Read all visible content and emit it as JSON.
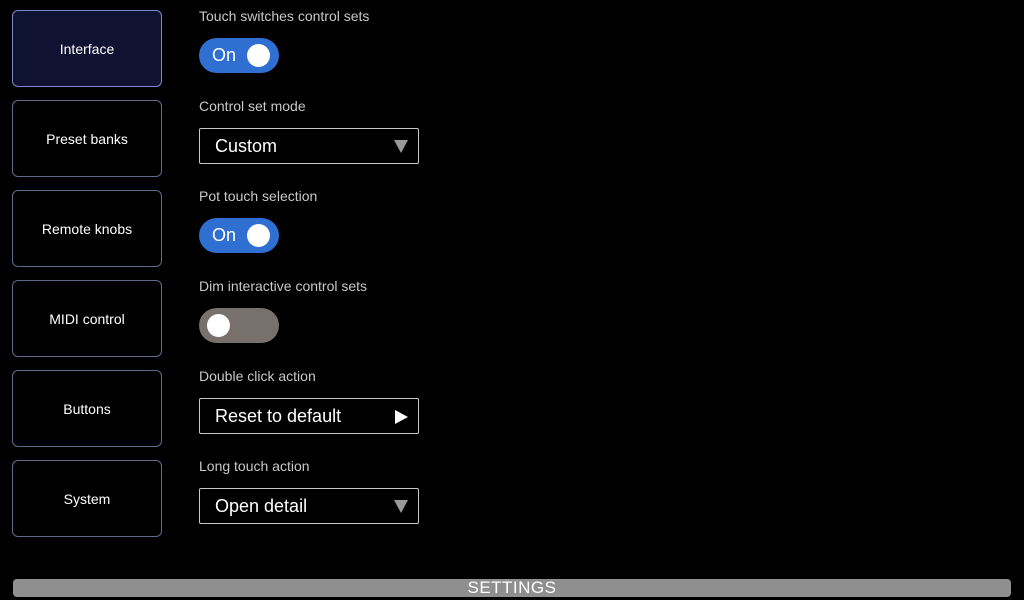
{
  "sidebar": {
    "items": [
      {
        "label": "Interface",
        "active": true
      },
      {
        "label": "Preset banks",
        "active": false
      },
      {
        "label": "Remote knobs",
        "active": false
      },
      {
        "label": "MIDI control",
        "active": false
      },
      {
        "label": "Buttons",
        "active": false
      },
      {
        "label": "System",
        "active": false
      }
    ]
  },
  "settings": {
    "touch_switches": {
      "label": "Touch switches control sets",
      "state": "On",
      "enabled": true
    },
    "control_set_mode": {
      "label": "Control set mode",
      "value": "Custom",
      "icon": "chevron-down-icon"
    },
    "pot_touch": {
      "label": "Pot touch selection",
      "state": "On",
      "enabled": true
    },
    "dim_interactive": {
      "label": "Dim interactive control sets",
      "state": "",
      "enabled": false
    },
    "double_click": {
      "label": "Double click action",
      "value": "Reset to default",
      "icon": "play-arrow-icon"
    },
    "long_touch": {
      "label": "Long touch action",
      "value": "Open detail",
      "icon": "chevron-down-icon"
    }
  },
  "footer": {
    "title": "SETTINGS"
  },
  "colors": {
    "toggle_on": "#2f6fd1",
    "toggle_off": "#78706c",
    "nav_active_bg": "#0f1230",
    "nav_border": "#5d6c8c",
    "footer_bar": "#8f8f8f"
  }
}
